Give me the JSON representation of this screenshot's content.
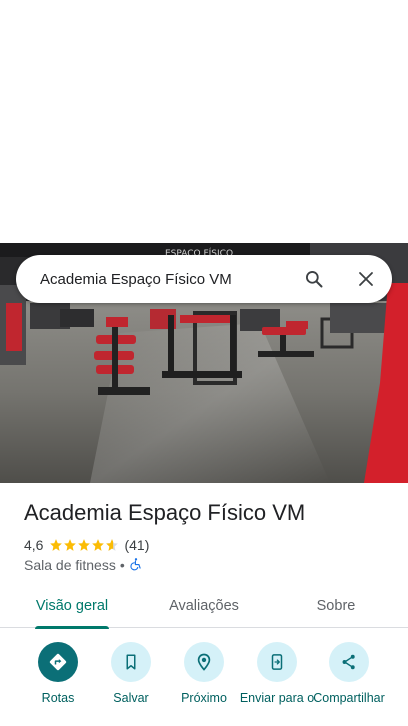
{
  "search": {
    "query": "Academia Espaço Físico VM",
    "search_icon": "search-icon",
    "close_icon": "close-icon"
  },
  "photo": {
    "wall_text": "ESPAÇO FÍSICO"
  },
  "place": {
    "name": "Academia Espaço Físico VM",
    "rating": "4,6",
    "rating_value": 4.6,
    "reviews_count": "(41)",
    "category": "Sala de fitness",
    "separator": "•",
    "accessibility_icon": "wheelchair-icon"
  },
  "tabs": [
    {
      "label": "Visão geral",
      "active": true
    },
    {
      "label": "Avaliações",
      "active": false
    },
    {
      "label": "Sobre",
      "active": false
    }
  ],
  "actions": [
    {
      "label": "Rotas",
      "icon": "directions-icon"
    },
    {
      "label": "Salvar",
      "icon": "bookmark-icon"
    },
    {
      "label": "Próximo",
      "icon": "nearby-icon"
    },
    {
      "label": "Enviar para o",
      "icon": "send-to-phone-icon"
    },
    {
      "label": "Compartilhar",
      "icon": "share-icon"
    }
  ],
  "colors": {
    "accent": "#00796b",
    "primary_action": "#0b6f77",
    "action_bg": "#d5f1f8",
    "star": "#fbbc04"
  }
}
